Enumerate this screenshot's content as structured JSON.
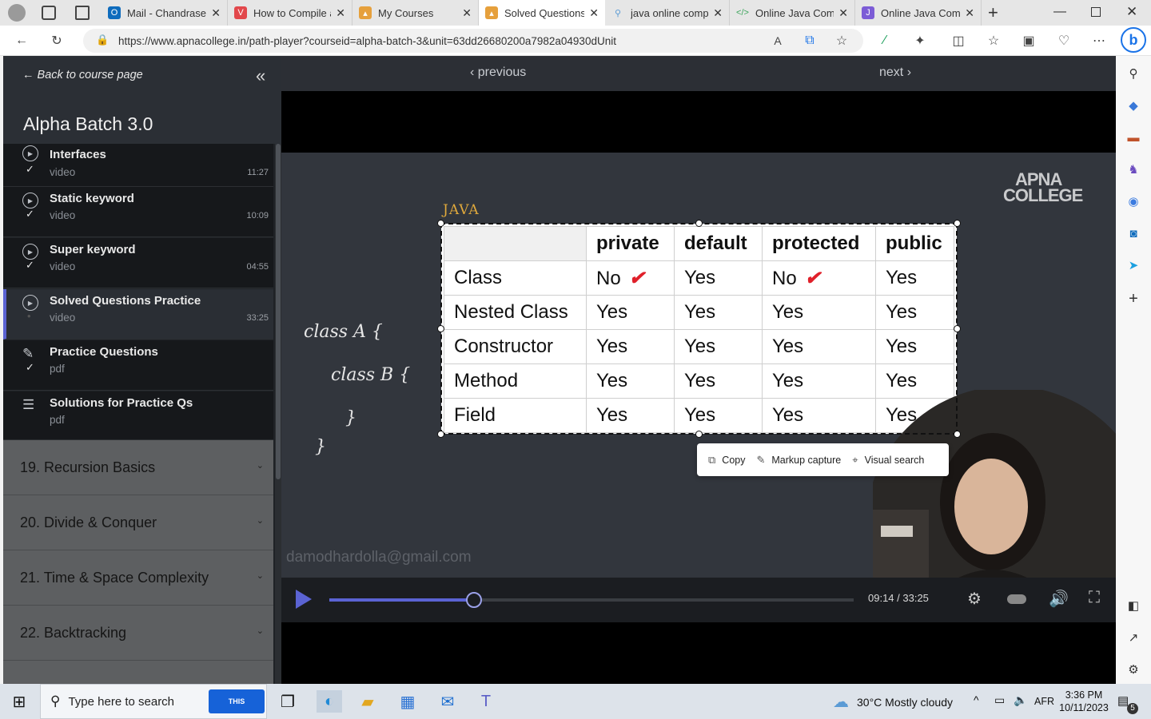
{
  "browser": {
    "tabs": [
      {
        "title": "Mail - Chandrasekhar",
        "favicon": "outlook-icon",
        "color": "#0f6cbd"
      },
      {
        "title": "How to Compile a Java Program",
        "favicon": "vivaldi-icon",
        "color": "#e2474b"
      },
      {
        "title": "My Courses",
        "favicon": "apna-college-icon",
        "color": "#e6a03c"
      },
      {
        "title": "Solved Questions Practice",
        "favicon": "apna-college-icon",
        "color": "#e6a03c",
        "active": true
      },
      {
        "title": "java online compiler",
        "favicon": "search-icon",
        "color": "#5b9bd5"
      },
      {
        "title": "Online Java Compiler",
        "favicon": "code-icon",
        "color": "#3ca55c"
      },
      {
        "title": "Online Java Compiler",
        "favicon": "code-purple-icon",
        "color": "#7c5cd6"
      }
    ],
    "url": "https://www.apnacollege.in/path-player?courseid=alpha-batch-3&unit=63dd26680200a7982a04930dUnit"
  },
  "sidebar": {
    "back_label": "← Back to course page",
    "course_title": "Alpha Batch 3.0",
    "lessons": [
      {
        "name": "Interfaces",
        "type": "video",
        "duration": "11:27"
      },
      {
        "name": "Static keyword",
        "type": "video",
        "duration": "10:09"
      },
      {
        "name": "Super keyword",
        "type": "video",
        "duration": "04:55"
      },
      {
        "name": "Solved Questions Practice",
        "type": "video",
        "duration": "33:25",
        "active": true
      },
      {
        "name": "Practice Questions",
        "type": "pdf",
        "duration": ""
      },
      {
        "name": "Solutions for Practice Qs",
        "type": "pdf",
        "duration": ""
      }
    ],
    "sections": [
      {
        "label": "19. Recursion Basics"
      },
      {
        "label": "20. Divide & Conquer"
      },
      {
        "label": "21. Time & Space Complexity"
      },
      {
        "label": "22. Backtracking"
      }
    ]
  },
  "player": {
    "previous_label": "‹ previous",
    "next_label": "next ›",
    "handwriting": {
      "java": "JAVA",
      "line1": "class A {",
      "line2": "class B {",
      "line3": "}",
      "line4": "}"
    },
    "logo": [
      "APNA",
      "COLLEGE"
    ],
    "watermark": "damodhardolla@gmail.com",
    "table": {
      "headers": [
        "",
        "private",
        "default",
        "protected",
        "public"
      ],
      "rows": [
        [
          "Class",
          "No",
          "Yes",
          "No",
          "Yes"
        ],
        [
          "Nested Class",
          "Yes",
          "Yes",
          "Yes",
          "Yes"
        ],
        [
          "Constructor",
          "Yes",
          "Yes",
          "Yes",
          "Yes"
        ],
        [
          "Method",
          "Yes",
          "Yes",
          "Yes",
          "Yes"
        ],
        [
          "Field",
          "Yes",
          "Yes",
          "Yes",
          "Yes"
        ]
      ]
    },
    "context_menu": {
      "copy": "Copy",
      "markup": "Markup capture",
      "visual_search": "Visual search"
    },
    "time": "09:14 / 33:25",
    "progress": 0.276
  },
  "taskbar": {
    "search_placeholder": "Type here to search",
    "bing_label": "THIS",
    "weather": "30°C  Mostly cloudy",
    "lang": "AFR",
    "time": "3:36 PM",
    "date": "10/11/2023",
    "notifications": "5"
  }
}
